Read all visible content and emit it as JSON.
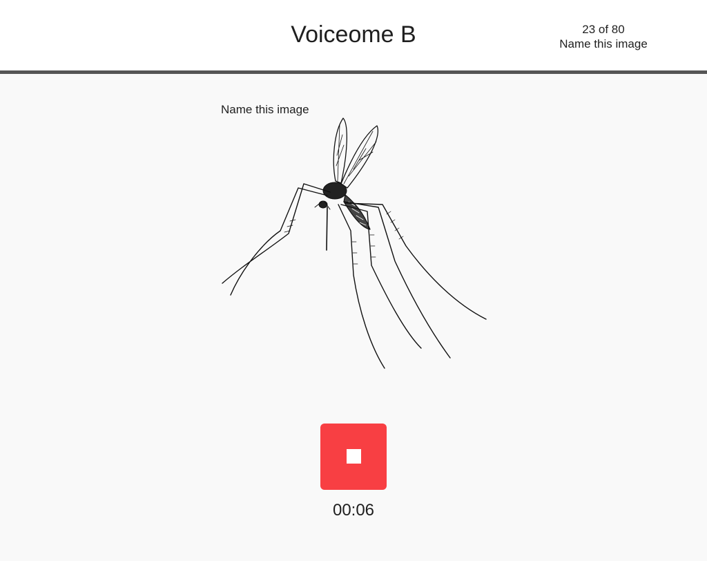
{
  "header": {
    "title": "Voiceome B",
    "progress": "23 of 80",
    "task_name": "Name this image"
  },
  "main": {
    "prompt": "Name this image",
    "stimulus_icon": "mosquito-illustration",
    "stop_button_icon": "stop-icon",
    "timer": "00:06"
  },
  "colors": {
    "stop_button": "#f83f43",
    "header_border": "#555555",
    "background": "#f9f9f9"
  }
}
